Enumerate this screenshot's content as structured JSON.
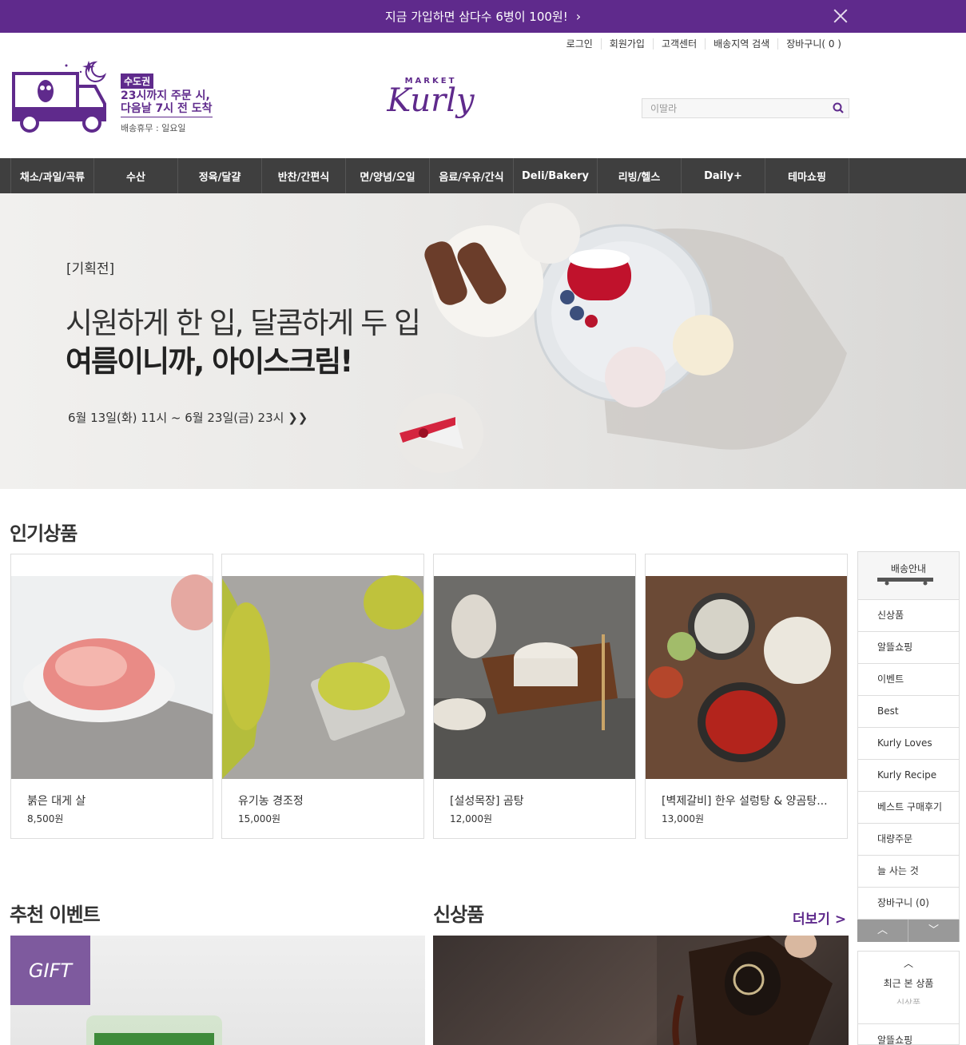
{
  "top_banner": {
    "text": "지금 가입하면 삼다수 6병이 100원!",
    "chevron": "›"
  },
  "user_menu": [
    "로그인",
    "회원가입",
    "고객센터",
    "배송지역 검색",
    "장바구니( 0 )"
  ],
  "delivery": {
    "tag": "수도권",
    "line1": "23시까지 주문 시,",
    "line2": "다음날 7시 전 도착",
    "sub": "배송휴무 : 일요일"
  },
  "logo": {
    "market": "MARKET",
    "kurly": "Kurly"
  },
  "search": {
    "placeholder": "이딸라"
  },
  "gnb": [
    "채소/과일/곡류",
    "수산",
    "정육/달걀",
    "반찬/간편식",
    "면/양념/오일",
    "음료/우유/간식",
    "Deli/Bakery",
    "리빙/헬스",
    "Daily+",
    "테마쇼핑"
  ],
  "hero": {
    "tag": "[기획전]",
    "line1": "시원하게 한 입, 달콤하게 두 입",
    "line2": "여름이니까, 아이스크림!",
    "date": "6월 13일(화) 11시 ~ 6월 23일(금) 23시  ❯❯"
  },
  "sections": {
    "popular": "인기상품",
    "events": "추천 이벤트",
    "new": "신상품",
    "more": "더보기 >"
  },
  "products": [
    {
      "name": "붉은 대게 살",
      "price": "8,500원"
    },
    {
      "name": "유기농 경조정",
      "price": "15,000원"
    },
    {
      "name": "[설성목장] 곰탕",
      "price": "12,000원"
    },
    {
      "name": "[벽제갈비] 한우 설렁탕 & 양곰탕...",
      "price": "13,000원"
    }
  ],
  "side": {
    "head": "배송안내",
    "items": [
      "신상품",
      "알뜰쇼핑",
      "이벤트",
      "Best",
      "Kurly Loves",
      "Kurly Recipe",
      "베스트 구매후기",
      "대량주문",
      "늘 사는 것",
      "장바구니 (0)"
    ],
    "up": "︿",
    "down": "﹀"
  },
  "recent": {
    "up": "︿",
    "title": "최근 본 상품",
    "ghost": "신상품",
    "item": "알뜰쇼핑"
  },
  "gift": "GIFT",
  "colors": {
    "brand": "#5f2a8c",
    "nav": "#3f3f3f"
  }
}
